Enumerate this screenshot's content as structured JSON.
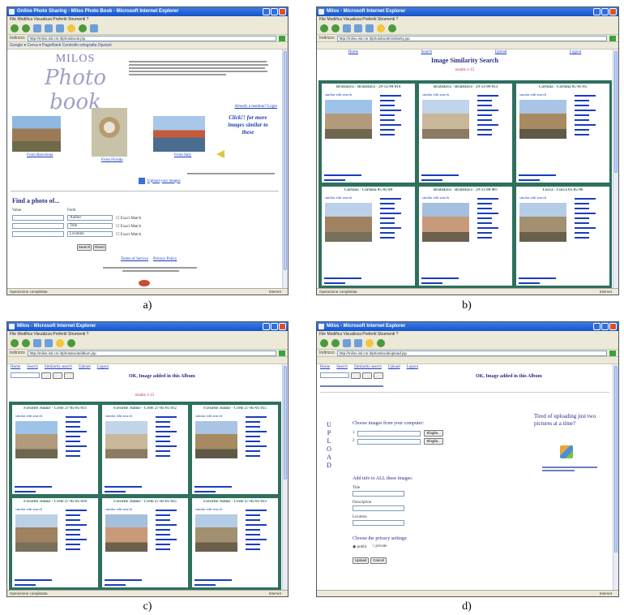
{
  "captions": {
    "a": "a)",
    "b": "b)",
    "c": "c)",
    "d": "d)"
  },
  "panel_a": {
    "window_title": "Online Photo Sharing - Milos Photo Book - Microsoft Internet Explorer",
    "menu": "File   Modifica   Visualizza   Preferiti   Strumenti   ?",
    "address_label": "Indirizzo",
    "address": "http://milos.isti.cnr.it/photobook.jsp",
    "google_bar": "Google  ▾   Cerca  ▾   PageRank   Controllo ortografia   Opzioni",
    "logo_top": "MILOS",
    "logo_script": "Photo book",
    "already_member": "Already a member? Login",
    "photo_captions": [
      "From Barcelona",
      "From Florida",
      "From Italy"
    ],
    "click_text": "Click!! for more images similar to these",
    "upload_link": "Upload your images",
    "find_title": "Find a photo of...",
    "field_labels": [
      "Author",
      "Title",
      "Location"
    ],
    "exact_match": "Exact Match",
    "search_button": "Search",
    "reset_button": "Reset",
    "footer_links": [
      "Terms of Service",
      "Privacy Policy"
    ],
    "status": "Operazione completata",
    "zone": "Internet"
  },
  "panel_b": {
    "window_title": "Milos - Microsoft Internet Explorer",
    "menu": "File   Modifica   Visualizza   Preferiti   Strumenti   ?",
    "address_label": "Indirizzo",
    "address": "http://milos.isti.cnr.it/photobook/similarity.jsp",
    "nav": [
      "Home",
      "Search",
      "Upload",
      "Logout"
    ],
    "page_title": "Image Similarity Search",
    "results": "results 1-15",
    "cells": [
      {
        "title": "Bratislava - Bratislava - 29-12-04 014"
      },
      {
        "title": "Bratislava - Bratislava - 29-12-04 013"
      },
      {
        "title": "Cortona - Cortona 05-05-05"
      },
      {
        "title": "Cortona - Cortona 05-05-04"
      },
      {
        "title": "Bratislava - Bratislava - 29-12-04 007"
      },
      {
        "title": "Lucca - Lucca 05-05-06"
      }
    ],
    "cell_links": "similar  edit  search",
    "status": "Operazione completata",
    "zone": "Internet"
  },
  "panel_c": {
    "window_title": "Milos - Microsoft Internet Explorer",
    "menu": "File   Modifica   Visualizza   Preferiti   Strumenti   ?",
    "address_label": "Indirizzo",
    "address": "http://milos.isti.cnr.it/photobook/album.jsp",
    "nav": [
      "Home",
      "Search",
      "Similarity search",
      "Upload",
      "Logout"
    ],
    "album_title": "OK, Image added in this Album",
    "results": "results 1-15",
    "cells": [
      {
        "title": "Favorite Junior - Crete 27-05-05 013"
      },
      {
        "title": "Favorite Junior - Crete 27-05-05 012"
      },
      {
        "title": "Favorite Junior - Crete 27-05-05 015"
      },
      {
        "title": "Favorite Junior - Crete 27-05-05 014"
      },
      {
        "title": "Favorite Junior - Crete 27-05-05 015"
      },
      {
        "title": "Favorite Junior - Crete 27-05-05 013"
      }
    ],
    "status": "Operazione completata",
    "zone": "Internet"
  },
  "panel_d": {
    "window_title": "Milos - Microsoft Internet Explorer",
    "menu": "File   Modifica   Visualizza   Preferiti   Strumenti   ?",
    "address_label": "Indirizzo",
    "address": "http://milos.isti.cnr.it/photobook/upload.jsp",
    "nav": [
      "Home",
      "Search",
      "Similarity search",
      "Upload",
      "Logout"
    ],
    "album_title": "OK, Image added in this Album",
    "upload_vertical": "UPLOAD",
    "choose_images": "Choose images from your computer:",
    "browse": "Sfoglia...",
    "tired_text": "Tired of uploading just two pictures at a time?",
    "add_info": "Add info to ALL these images:",
    "field_labels": [
      "Title",
      "Description",
      "Location"
    ],
    "privacy_title": "Choose the privacy settings:",
    "privacy_options": [
      "public",
      "private"
    ],
    "upload_button": "Upload",
    "cancel_button": "Cancel",
    "status": "",
    "zone": "Internet"
  }
}
